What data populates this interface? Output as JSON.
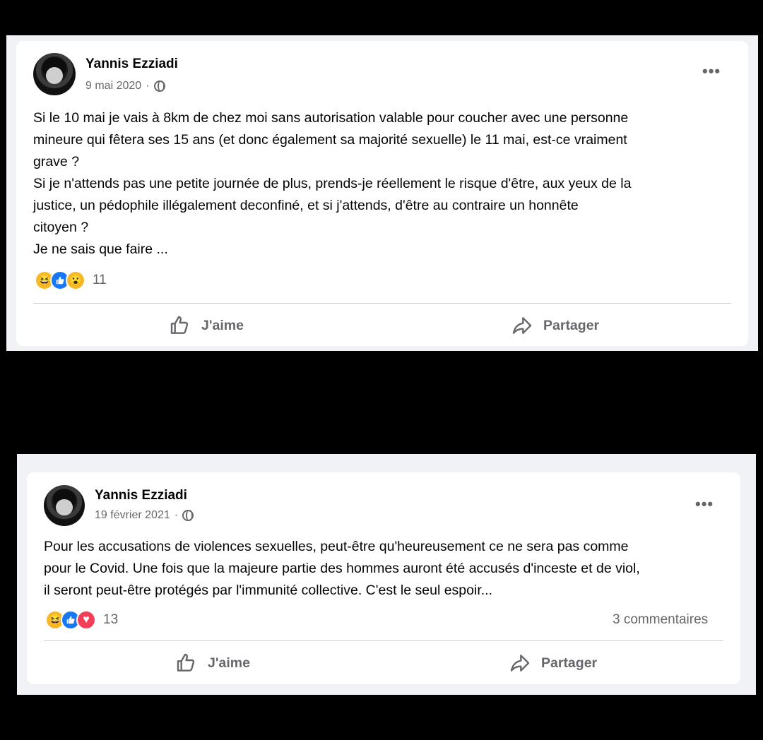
{
  "posts": [
    {
      "author": "Yannis Ezziadi",
      "date": "9 mai 2020",
      "separator": "·",
      "more_label": "•••",
      "text": "Si le 10 mai je vais à 8km de chez moi sans autorisation valable pour coucher avec une personne\nmineure qui fêtera ses 15 ans (et donc également sa majorité sexuelle) le 11 mai, est-ce vraiment\ngrave ?\nSi je n'attends pas une petite journée de plus, prends-je réellement le risque d'être, aux yeux de la\njustice, un pédophile illégalement deconfiné,  et si j'attends, d'être au contraire un honnête\ncitoyen ?\nJe ne sais que faire ...",
      "reactions": [
        "haha",
        "like",
        "wow"
      ],
      "reaction_count": "11",
      "like_label": "J'aime",
      "share_label": "Partager"
    },
    {
      "author": "Yannis Ezziadi",
      "date": "19 février 2021",
      "separator": "·",
      "more_label": "•••",
      "text": "Pour les accusations de violences sexuelles, peut-être qu'heureusement ce ne sera pas comme\npour le Covid. Une fois que la majeure partie des hommes auront été accusés d'inceste et de viol,\nil seront peut-être protégés  par l'immunité collective. C'est le seul espoir...",
      "reactions": [
        "haha",
        "like",
        "love"
      ],
      "reaction_count": "13",
      "comments": "3 commentaires",
      "like_label": "J'aime",
      "share_label": "Partager"
    }
  ],
  "icons": {
    "haha": "😆",
    "like": "👍",
    "wow": "😮",
    "love": "♥"
  }
}
